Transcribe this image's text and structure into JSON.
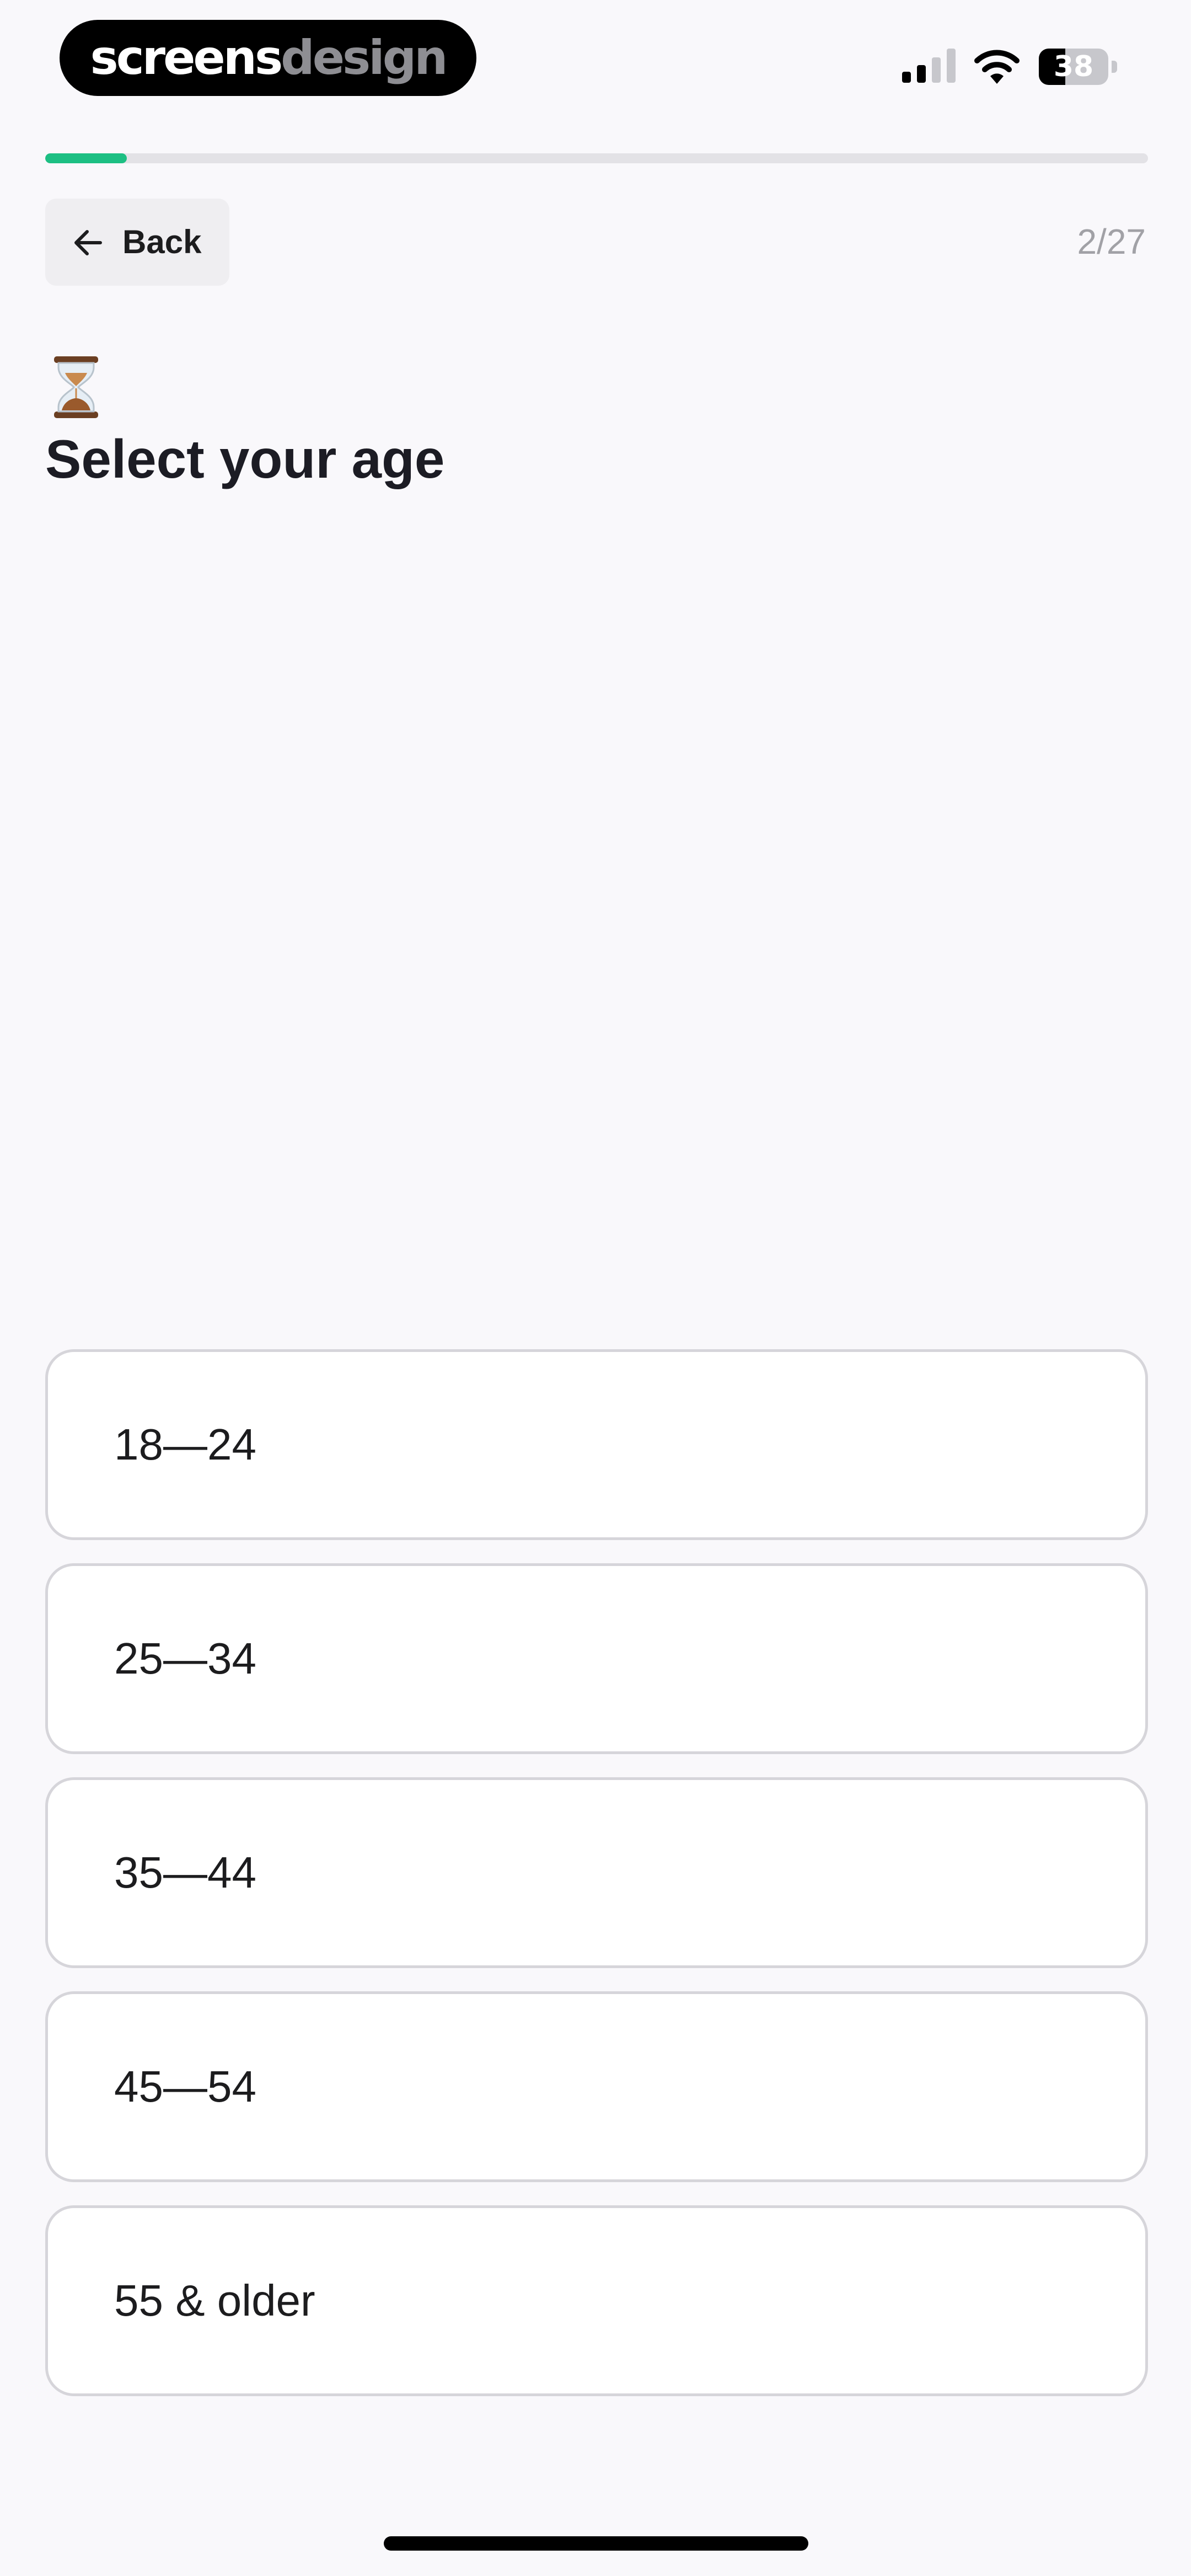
{
  "status_bar": {
    "brand_part_1": "screens",
    "brand_part_2": "design",
    "battery_level": "38",
    "battery_fraction": 0.38
  },
  "progress": {
    "fraction": 0.074,
    "fill_color": "#1dbf83"
  },
  "header": {
    "back_label": "Back",
    "step_counter": "2/27"
  },
  "question": {
    "icon": "hourglass-icon",
    "title": "Select your age"
  },
  "options": [
    {
      "label": "18—24"
    },
    {
      "label": "25—34"
    },
    {
      "label": "35—44"
    },
    {
      "label": "45—54"
    },
    {
      "label": "55 & older"
    }
  ]
}
